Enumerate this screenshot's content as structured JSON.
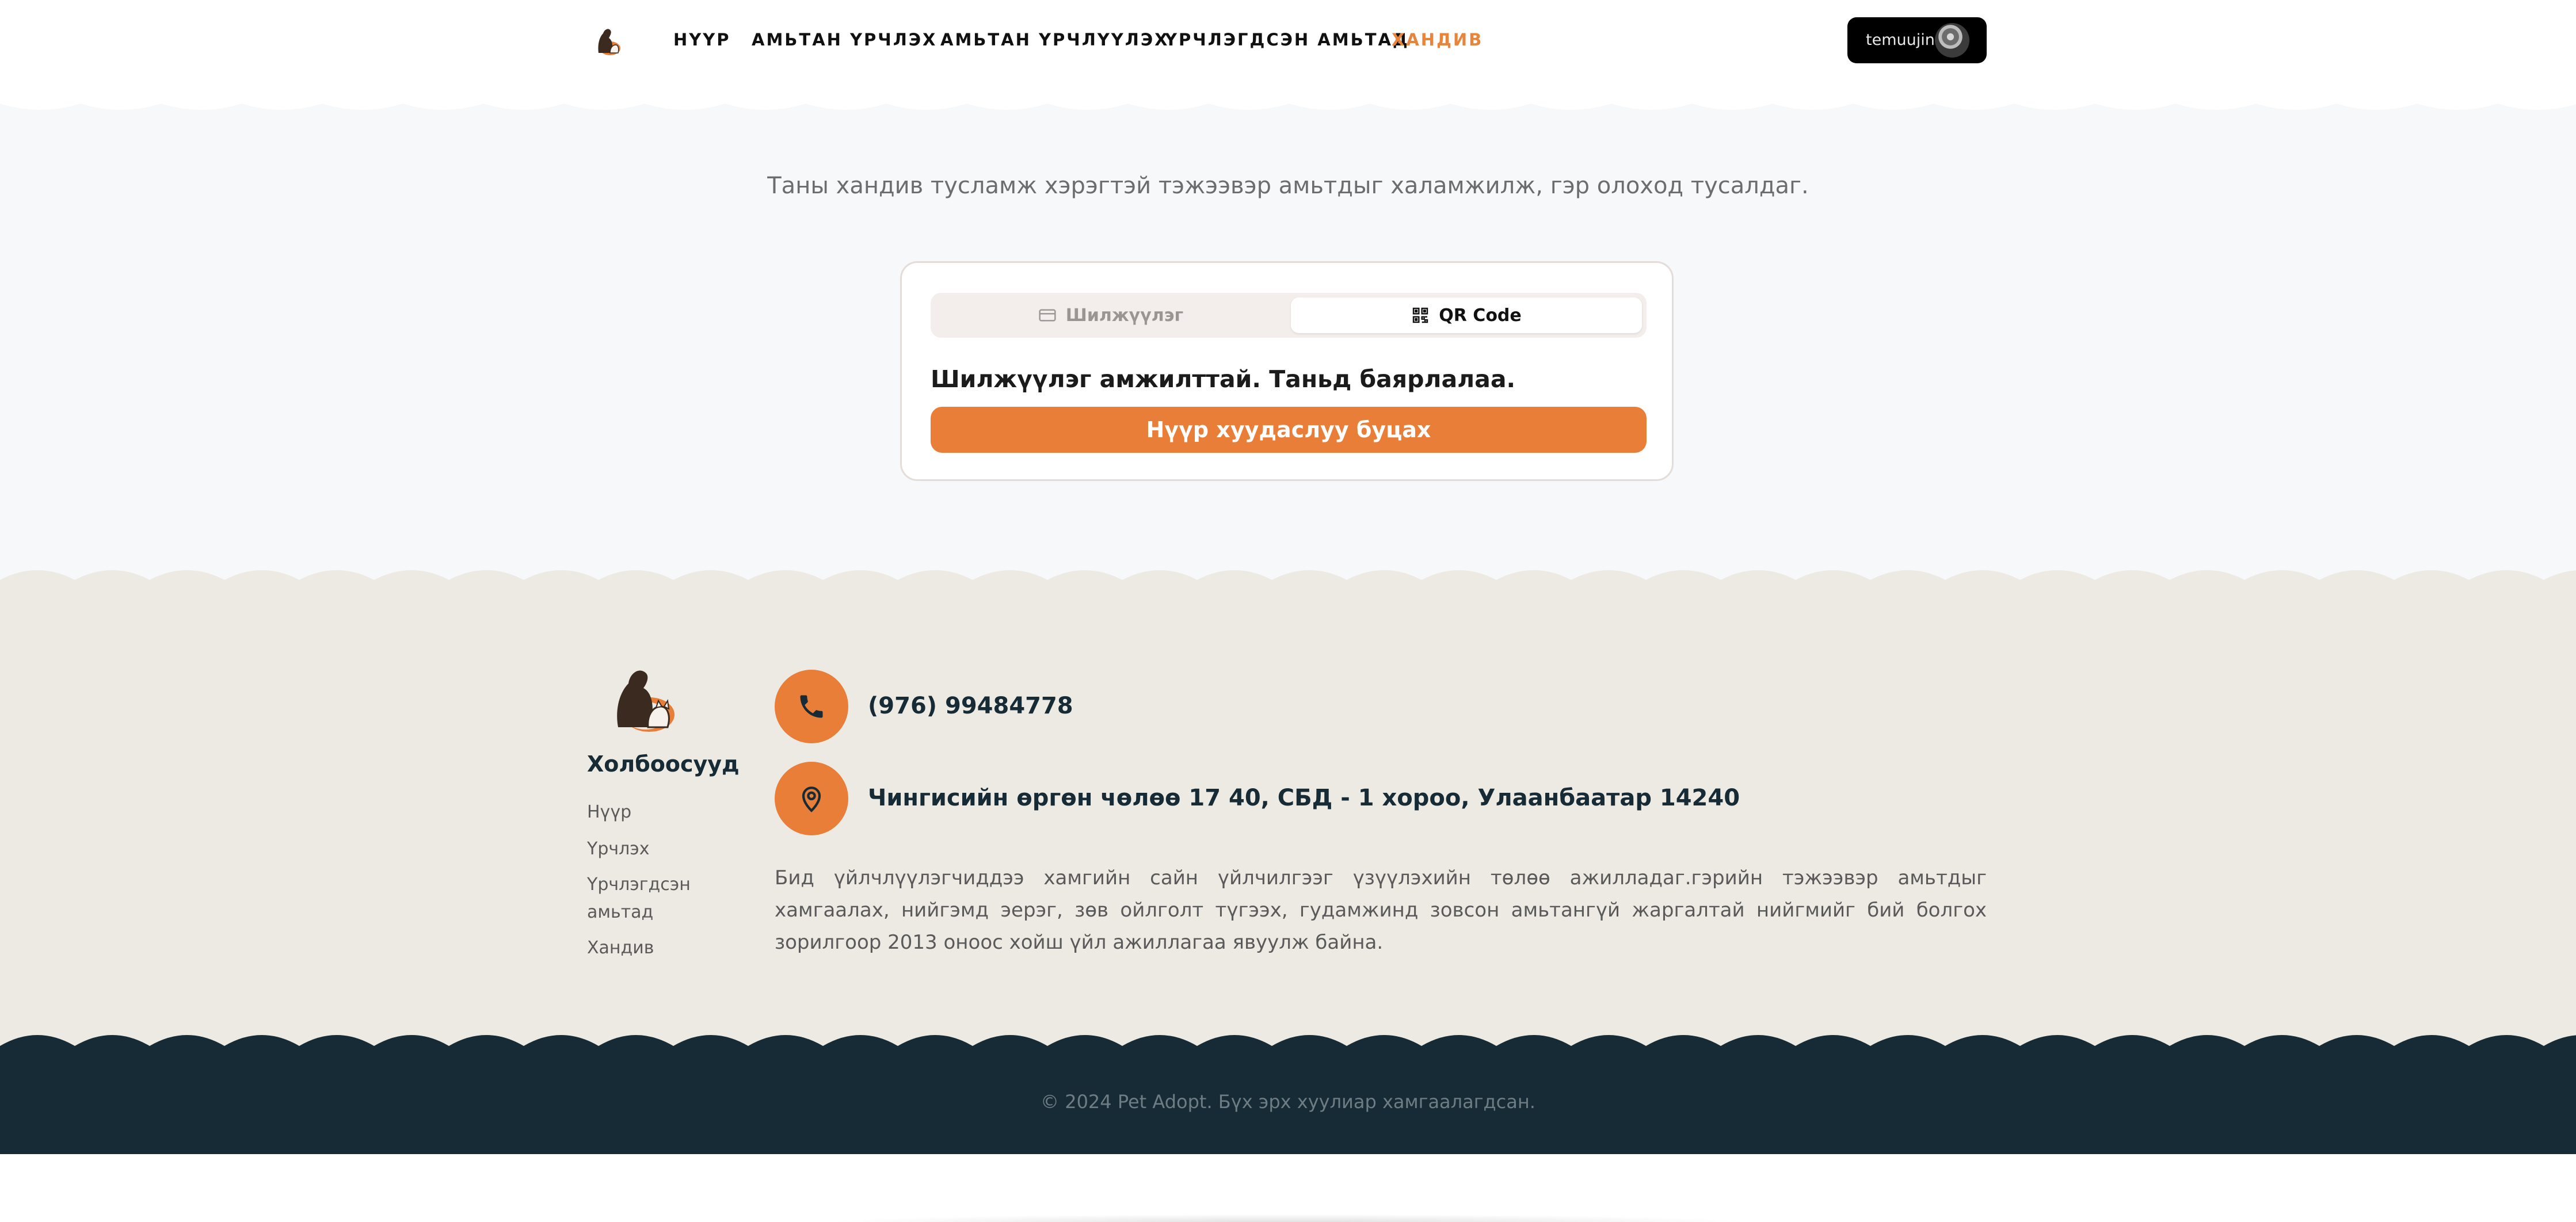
{
  "nav": {
    "items": [
      {
        "label": "НҮҮР"
      },
      {
        "label": "АМЬТАН ҮРЧЛЭХ"
      },
      {
        "label": "АМЬТАН ҮРЧЛҮҮЛЭХ"
      },
      {
        "label": "ҮРЧЛЭГДСЭН АМЬТАД"
      },
      {
        "label": "ХАНДИВ"
      }
    ],
    "active_color": "#e9843b",
    "user": {
      "name": "temuujin"
    }
  },
  "main": {
    "lead": "Таны хандив тусламж хэрэгтэй тэжээвэр амьтдыг халамжилж, гэр олоход тусалдаг.",
    "tabs": [
      {
        "label": "Шилжүүлэг",
        "icon": "credit-card-icon"
      },
      {
        "label": "QR Code",
        "icon": "qr-code-icon"
      }
    ],
    "selected_tab": "QR Code",
    "success_message": "Шилжүүлэг амжилттай. Таньд баярлалаа.",
    "home_button": "Нүүр хуудаслуу буцах",
    "accent": "#e87e37"
  },
  "footer": {
    "heading": "Холбоосууд",
    "links": [
      {
        "label": "Нүүр"
      },
      {
        "label": "Үрчлэх"
      },
      {
        "label": "Үрчлэгдсэн амьтад"
      },
      {
        "label": "Хандив"
      }
    ],
    "phone": "(976) 99484778",
    "address": "Чингисийн өргөн чөлөө 17 40, СБД - 1 хороо, Улаанбаатар 14240",
    "about": "Бид үйлчлүүлэгчиддээ хамгийн сайн үйлчилгээг үзүүлэхийн төлөө ажилладаг.гэрийн тэжээвэр амьтдыг хамгаалах, нийгэмд эерэг, зөв ойлголт түгээх, гудамжинд зовсон амьтангүй жаргалтай нийгмийг бий болгох зорилгоор 2013 оноос хойш үйл ажиллагаа явуулж байна.",
    "copyright": "© 2024 Pet Adopt. Бүх эрх хуулиар хамгаалагдсан.",
    "background": "#edeae4",
    "dark": "#172b36"
  }
}
